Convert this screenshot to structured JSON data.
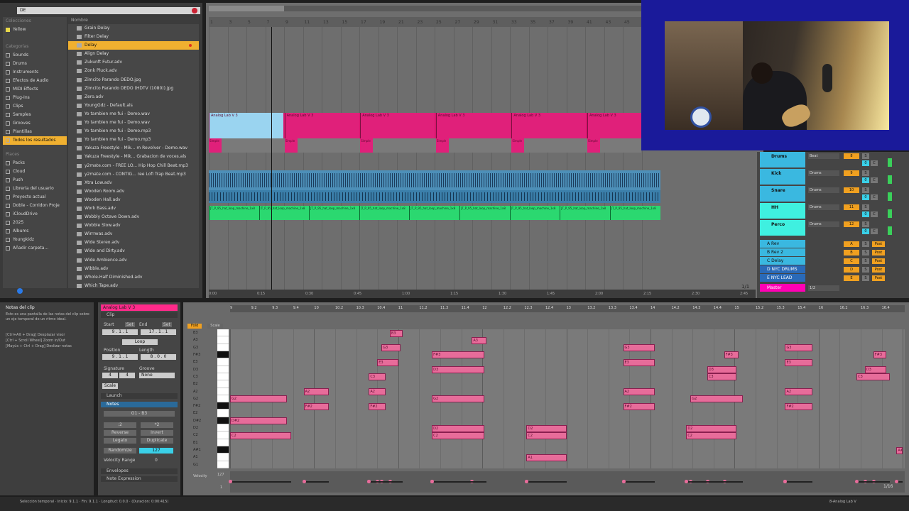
{
  "browser": {
    "search_value": "DE",
    "sections": {
      "collections": "Colecciones",
      "categories": "Categorías",
      "places": "Places"
    },
    "collection_items": [
      "Yellow"
    ],
    "categories": [
      "Sounds",
      "Drums",
      "Instruments",
      "Efectos de Audio",
      "MIDI Effects",
      "Plug-Ins",
      "Clips",
      "Samples",
      "Grooves",
      "Plantillas",
      "Todos los resultados"
    ],
    "places": [
      "Packs",
      "Cloud",
      "Push",
      "Librería del usuario",
      "Proyecto actual",
      "Doble - Corridon Proje",
      "iCloudDrive",
      "2025",
      "Albums",
      "Youngkidz",
      "Añadir carpeta..."
    ],
    "file_header": "Nombre",
    "files": [
      "Grain Delay",
      "Filter Delay",
      "Delay",
      "Align Delay",
      "Zukunft Futur.adv",
      "Zonk Pluck.adv",
      "Zimcito Parando DEDO.jpg",
      "Zimcito Parando DEDO (HDTV (1080)).jpg",
      "Zero.adv",
      "YoungGdz - Default.als",
      "Yo tambien me fui - Demo.wav",
      "Yo tambien me fui - Demo.wav",
      "Yo tambien me fui - Demo.mp3",
      "Yo tambien me fui - Demo.mp3",
      "Yakuza Freestyle - Mik... m Revolver - Demo.wav",
      "Yakuza Freestyle - Mik... Grabacion de voces.als",
      "y2mate.com - FREE LO... Hip Hop Chill Beat.mp3",
      "y2mate.com - CONTIG... ree Lofi Trap Beat.mp3",
      "Xtra Low.adv",
      "Wooden Room.adv",
      "Wooden Hall.adv",
      "Work Bass.adv",
      "Wobbly Octave Down.adv",
      "Wobble Slow.adv",
      "Wirrrwas.adv",
      "Wide Stereo.adv",
      "Wide and Dirty.adv",
      "Wide Ambience.adv",
      "Wibble.adv",
      "Whole-Half Diminished.adv",
      "Which Tape.adv"
    ],
    "selected_file_index": 2
  },
  "arrangement": {
    "bar_numbers": [
      "1",
      "3",
      "5",
      "7",
      "9",
      "11",
      "13",
      "15",
      "17",
      "19",
      "21",
      "23",
      "25",
      "27",
      "29",
      "31",
      "33",
      "35",
      "37",
      "39",
      "41",
      "43",
      "45"
    ],
    "time_labels": [
      "0:00",
      "0:15",
      "0:30",
      "0:45",
      "1:00",
      "1:15",
      "1:30",
      "1:45",
      "2:00",
      "2:15",
      "2:30",
      "2:45"
    ],
    "clip_names": {
      "analog": "Analog Lab V 3",
      "simple": "Simple",
      "hat": "JT_P_95_hat_loop_machine_1x8"
    },
    "page_counter": "1/1"
  },
  "mixer": {
    "tracks": [
      {
        "name": "Drums",
        "color": "#3ab8e0",
        "input": "Beat",
        "num": "8"
      },
      {
        "name": "Kick",
        "color": "#3ab8e0",
        "input": "Drums",
        "num": "9"
      },
      {
        "name": "Snare",
        "color": "#3ab8e0",
        "input": "Drums",
        "num": "10"
      },
      {
        "name": "HH",
        "color": "#3ff0e0",
        "input": "Drums",
        "num": "11"
      },
      {
        "name": "Perco",
        "color": "#3ff0e0",
        "input": "Drums",
        "num": "12"
      }
    ],
    "returns": [
      {
        "name": "A Rev",
        "letter": "A"
      },
      {
        "name": "B Rev 2",
        "letter": "B"
      },
      {
        "name": "C Delay",
        "letter": "C"
      },
      {
        "name": "D NYC DRUMS",
        "letter": "D"
      },
      {
        "name": "E NYC LEAD",
        "letter": "E"
      }
    ],
    "master_name": "Master",
    "master_value": "1/2",
    "btn_s": "S",
    "btn_post": "Post",
    "btn_zero": "0",
    "btn_c": "C"
  },
  "info_view": {
    "title": "Notas del clip",
    "body": "Esto es una pantalla de las notas del clip sobre un eje temporal de un ritmo ideal.",
    "tips": "[Ctrl+Alt + Drag] Desplazar visor\n[Ctrl + Scroll Wheel] Zoom in/Out\n[Mayús + Ctrl + Drag] Deslizar notas"
  },
  "clip": {
    "name": "Analog Lab V 3",
    "clip_label": "Clip",
    "start_label": "Start",
    "end_label": "End",
    "set_label": "Set",
    "start_value": "9 . 1 . 1",
    "end_value": "17 . 1 . 1",
    "loop_label": "Loop",
    "position_label": "Position",
    "length_label": "Length",
    "position_value": "9 . 1 . 1",
    "length_value": "8 . 0 . 0",
    "signature_label": "Signature",
    "groove_label": "Groove",
    "sig_num": "4",
    "sig_den": "4",
    "groove_value": "None",
    "scale_label": "Scale",
    "launch_label": "Launch",
    "notes_label": "Notes",
    "note_range": "G1 - B3",
    "half": ":2",
    "double": "*2",
    "reverse": "Reverse",
    "invert": "Invert",
    "legato": "Legato",
    "duplicate": "Duplicate",
    "randomize": "Randomize",
    "randomize_value": "127",
    "velocity_range": "Velocity Range",
    "velocity_range_value": "0",
    "envelopes": "Envelopes",
    "note_expression": "Note Expression"
  },
  "piano_roll": {
    "fold": "Fold",
    "scale": "Scale",
    "ruler": [
      "9",
      "9.2",
      "9.3",
      "9.4",
      "10",
      "10.2",
      "10.3",
      "10.4",
      "11",
      "11.2",
      "11.3",
      "11.4",
      "12",
      "12.2",
      "12.3",
      "12.4",
      "13",
      "13.2",
      "13.3",
      "13.4",
      "14",
      "14.2",
      "14.3",
      "14.4",
      "15",
      "15.2",
      "15.3",
      "15.4",
      "16",
      "16.2",
      "16.3",
      "16.4"
    ],
    "key_labels": [
      "B3",
      "A3",
      "G3",
      "F#3",
      "E3",
      "D3",
      "C3",
      "B2",
      "A2",
      "G2",
      "F#2",
      "E2",
      "D#2",
      "D2",
      "C2",
      "B1",
      "A#1",
      "A1",
      "G1"
    ],
    "velocity_label": "Velocity",
    "velocity_max": "127",
    "velocity_min": "1",
    "zoom_readout": "1/16"
  },
  "status_bar": {
    "text": "Selección temporal · Inicio: 9.1.1 · Fin: 9.1.1 · Longitud: 0.0.0 · (Duración: 0:00:415)",
    "right_label": "8-Analog Lab V"
  }
}
